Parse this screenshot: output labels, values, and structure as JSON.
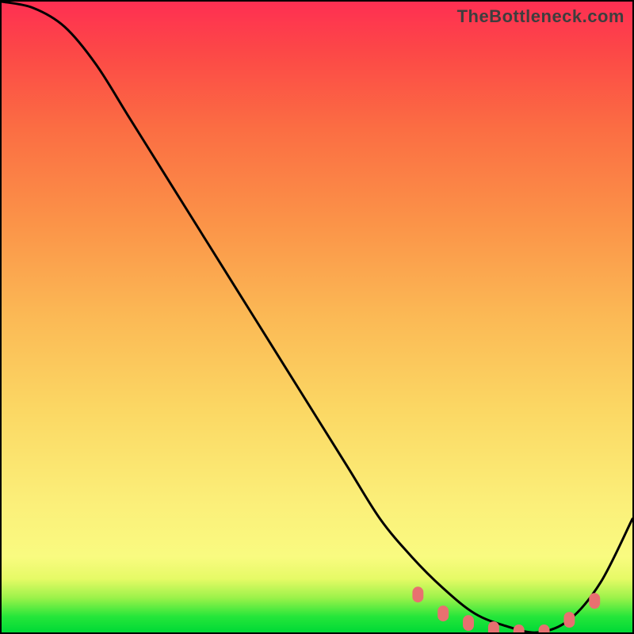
{
  "watermark": "TheBottleneck.com",
  "chart_data": {
    "type": "line",
    "title": "",
    "xlabel": "",
    "ylabel": "",
    "x": [
      0.0,
      0.05,
      0.1,
      0.15,
      0.2,
      0.25,
      0.3,
      0.35,
      0.4,
      0.45,
      0.5,
      0.55,
      0.6,
      0.65,
      0.7,
      0.75,
      0.8,
      0.85,
      0.9,
      0.95,
      1.0
    ],
    "values": [
      1.0,
      0.99,
      0.96,
      0.9,
      0.82,
      0.74,
      0.66,
      0.58,
      0.5,
      0.42,
      0.34,
      0.26,
      0.18,
      0.12,
      0.07,
      0.03,
      0.01,
      0.0,
      0.02,
      0.08,
      0.18
    ],
    "xlim": [
      0,
      1
    ],
    "ylim": [
      0,
      1
    ],
    "marker_points_x": [
      0.66,
      0.7,
      0.74,
      0.78,
      0.82,
      0.86,
      0.9,
      0.94
    ],
    "marker_points_y": [
      0.06,
      0.03,
      0.015,
      0.005,
      0.0,
      0.0,
      0.02,
      0.05
    ],
    "curve_color": "#000000",
    "marker_color": "#e87070",
    "background_gradient": [
      "#00d936",
      "#fbf07a",
      "#ff2f52"
    ]
  }
}
